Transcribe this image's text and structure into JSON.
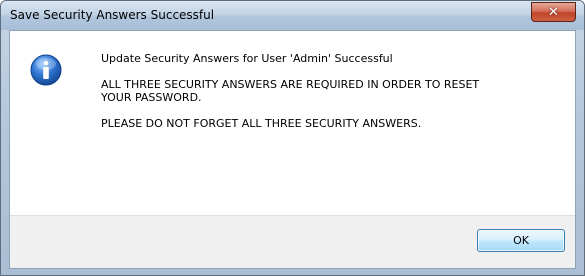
{
  "window": {
    "title": "Save Security Answers Successful",
    "close_icon": "close-icon"
  },
  "dialog": {
    "icon": "info-icon",
    "messages": [
      "Update Security Answers for User 'Admin' Successful",
      "ALL THREE SECURITY ANSWERS ARE REQUIRED IN ORDER TO RESET\nYOUR PASSWORD.",
      "PLEASE DO NOT FORGET ALL THREE SECURITY ANSWERS."
    ],
    "ok_label": "OK"
  },
  "colors": {
    "accent": "#1a5fb4",
    "close_button": "#c7472b"
  }
}
